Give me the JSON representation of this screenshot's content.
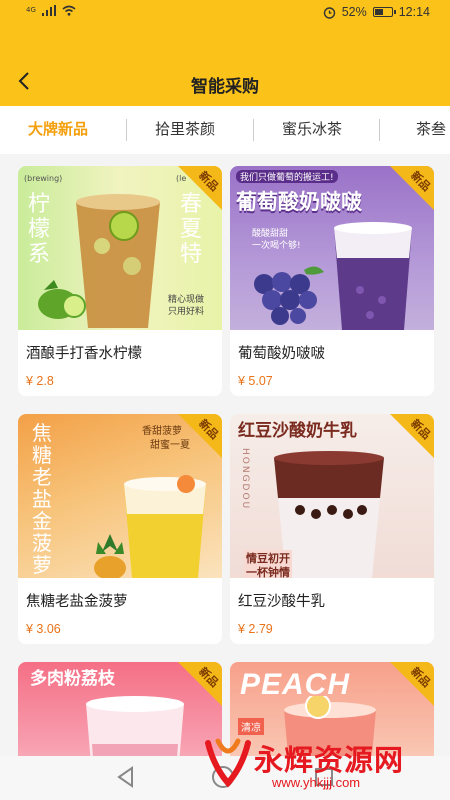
{
  "status_bar": {
    "network": "4G",
    "battery": "52%",
    "time": "12:14",
    "battery_level": 0.52
  },
  "header": {
    "title": "智能采购"
  },
  "tabs": [
    {
      "label": "大牌新品",
      "active": true
    },
    {
      "label": "拾里茶颜",
      "active": false
    },
    {
      "label": "蜜乐冰茶",
      "active": false
    },
    {
      "label": "茶叁",
      "active": false
    }
  ],
  "products": [
    {
      "name": "酒酿手打香水柠檬",
      "price": "¥ 2.8",
      "badge": "新品",
      "image_text": {
        "top_left": "(brewing)",
        "top_right": "(le",
        "vertical_left": "柠檬系",
        "vertical_right": "春夏特",
        "caption1": "精心现做",
        "caption2": "只用好料"
      }
    },
    {
      "name": "葡萄酸奶啵啵",
      "price": "¥ 5.07",
      "badge": "新品",
      "image_text": {
        "subtitle": "我们只做葡萄的搬运工!",
        "headline": "葡萄酸奶啵啵",
        "note1": "酸酸甜甜",
        "note2": "一次喝个够!"
      }
    },
    {
      "name": "焦糖老盐金菠萝",
      "price": "¥ 3.06",
      "badge": "新品",
      "image_text": {
        "vertical": "焦糖老盐金菠萝",
        "note1": "香甜菠萝",
        "note2": "甜蜜一夏"
      }
    },
    {
      "name": "红豆沙酸牛乳",
      "price": "¥ 2.79",
      "badge": "新品",
      "image_text": {
        "headline": "红豆沙酸奶牛乳",
        "side": "HONGDOU",
        "note1": "情豆初开",
        "note2": "一杯钟情"
      }
    },
    {
      "name": "多肉粉荔枝",
      "price": "",
      "badge": "新品",
      "image_text": {
        "headline": "多肉粉荔枝"
      }
    },
    {
      "name": "PEACH",
      "price": "",
      "badge": "新品",
      "image_text": {
        "headline": "PEACH",
        "tag": "清凉"
      }
    }
  ],
  "watermark": {
    "title": "永辉资源网",
    "url": "www.yhkjjj.com"
  },
  "colors": {
    "header": "#fbc21a",
    "active_tab": "#f49f0c",
    "price": "#e8731a",
    "badge": "#f5b819"
  }
}
